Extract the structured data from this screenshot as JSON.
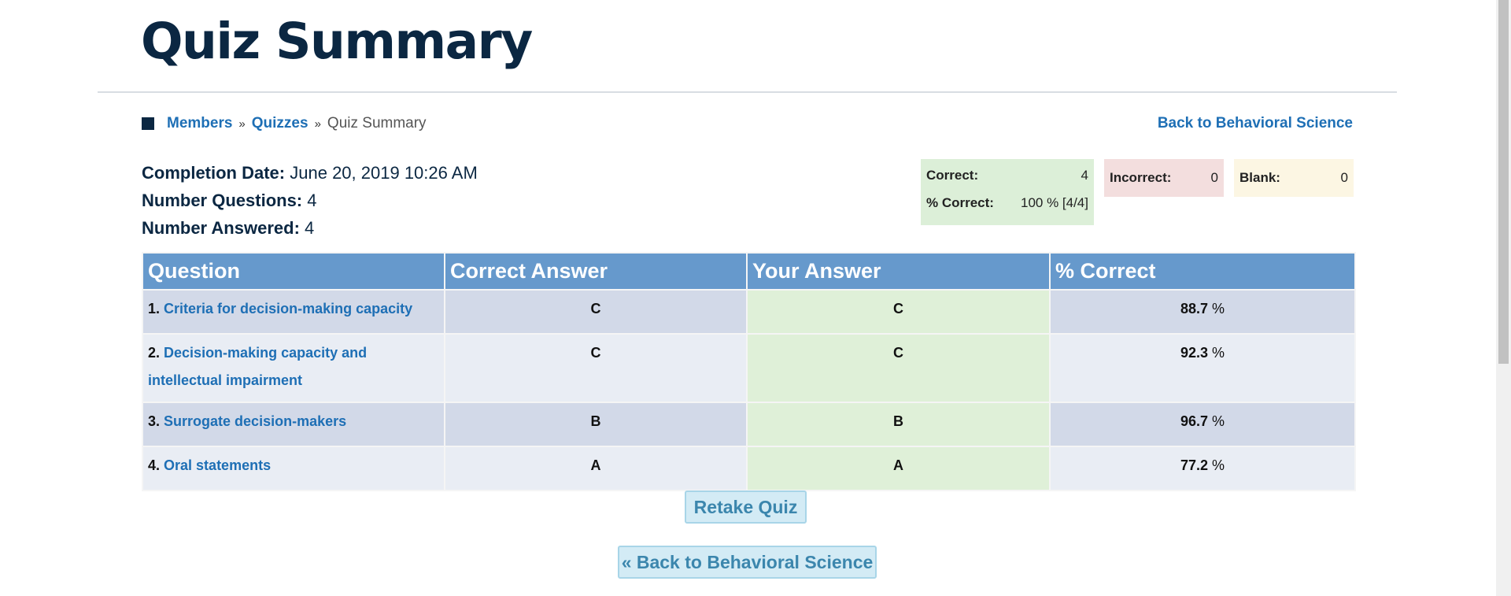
{
  "page": {
    "title": "Quiz Summary"
  },
  "breadcrumb": {
    "members": "Members",
    "quizzes": "Quizzes",
    "current": "Quiz Summary",
    "separator": "»"
  },
  "back_link": "Back to Behavioral Science",
  "info": {
    "completion_date_label": "Completion Date:",
    "completion_date": "June 20, 2019 10:26 AM",
    "num_questions_label": "Number Questions:",
    "num_questions": "4",
    "num_answered_label": "Number Answered:",
    "num_answered": "4"
  },
  "stats": {
    "correct_label": "Correct:",
    "correct": "4",
    "percent_label": "% Correct:",
    "percent": "100 % [4/4]",
    "incorrect_label": "Incorrect:",
    "incorrect": "0",
    "blank_label": "Blank:",
    "blank": "0"
  },
  "table": {
    "headers": [
      "Question",
      "Correct Answer",
      "Your Answer",
      "% Correct"
    ],
    "rows": [
      {
        "num": "1.",
        "question": "Criteria for decision-making capacity",
        "correct": "C",
        "yours": "C",
        "pct": "88.7",
        "unit": "%"
      },
      {
        "num": "2.",
        "question": "Decision-making capacity and intellectual impairment",
        "correct": "C",
        "yours": "C",
        "pct": "92.3",
        "unit": "%"
      },
      {
        "num": "3.",
        "question": "Surrogate decision-makers",
        "correct": "B",
        "yours": "B",
        "pct": "96.7",
        "unit": "%"
      },
      {
        "num": "4.",
        "question": "Oral statements",
        "correct": "A",
        "yours": "A",
        "pct": "77.2",
        "unit": "%"
      }
    ]
  },
  "buttons": {
    "retake": "Retake Quiz",
    "back": "« Back to Behavioral Science"
  },
  "colors": {
    "header_bg": "#6699cc",
    "link": "#1e6fb5",
    "title": "#0b2742",
    "correct_bg": "#dcefd8",
    "incorrect_bg": "#f3dede",
    "blank_bg": "#fcf6e3"
  }
}
